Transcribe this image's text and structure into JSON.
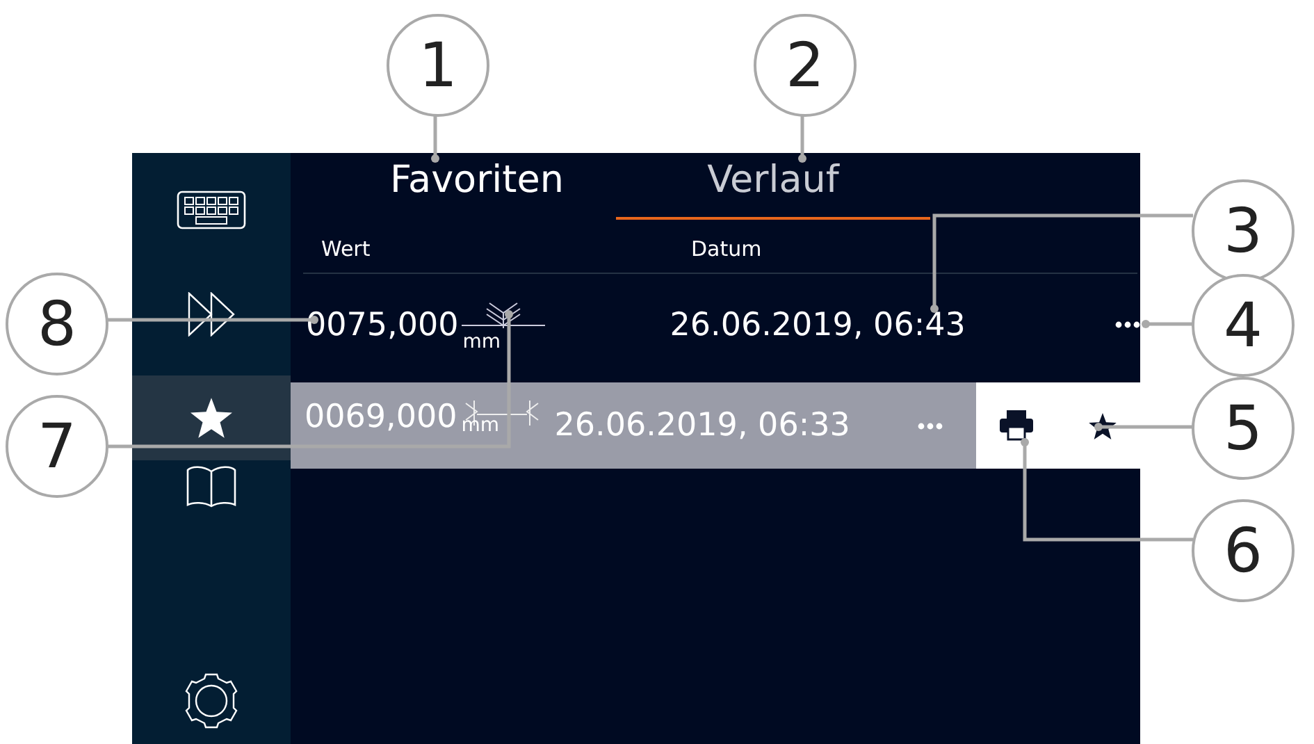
{
  "sidebar": {
    "items": [
      {
        "kind": "keyboard",
        "selected": false
      },
      {
        "kind": "forward",
        "selected": false
      },
      {
        "kind": "star",
        "selected": true
      },
      {
        "kind": "book",
        "selected": false
      },
      {
        "kind": "settings",
        "selected": false
      }
    ]
  },
  "tabs": [
    {
      "label": "Favoriten",
      "selected": false
    },
    {
      "label": "Verlauf",
      "selected": true
    }
  ],
  "table": {
    "columns": [
      "Wert",
      "Datum"
    ],
    "rows": [
      {
        "value": "0075,000",
        "unit": "mm",
        "kind": "outside",
        "date": "26.06.2019, 06:43",
        "swiped": false
      },
      {
        "value": "0069,000",
        "unit": "mm",
        "kind": "inside",
        "date": "26.06.2019, 06:33",
        "swiped": true
      }
    ]
  },
  "callouts": [
    {
      "label": "1"
    },
    {
      "label": "2"
    },
    {
      "label": "3"
    },
    {
      "label": "4"
    },
    {
      "label": "5"
    },
    {
      "label": "6"
    },
    {
      "label": "7"
    },
    {
      "label": "8"
    }
  ]
}
